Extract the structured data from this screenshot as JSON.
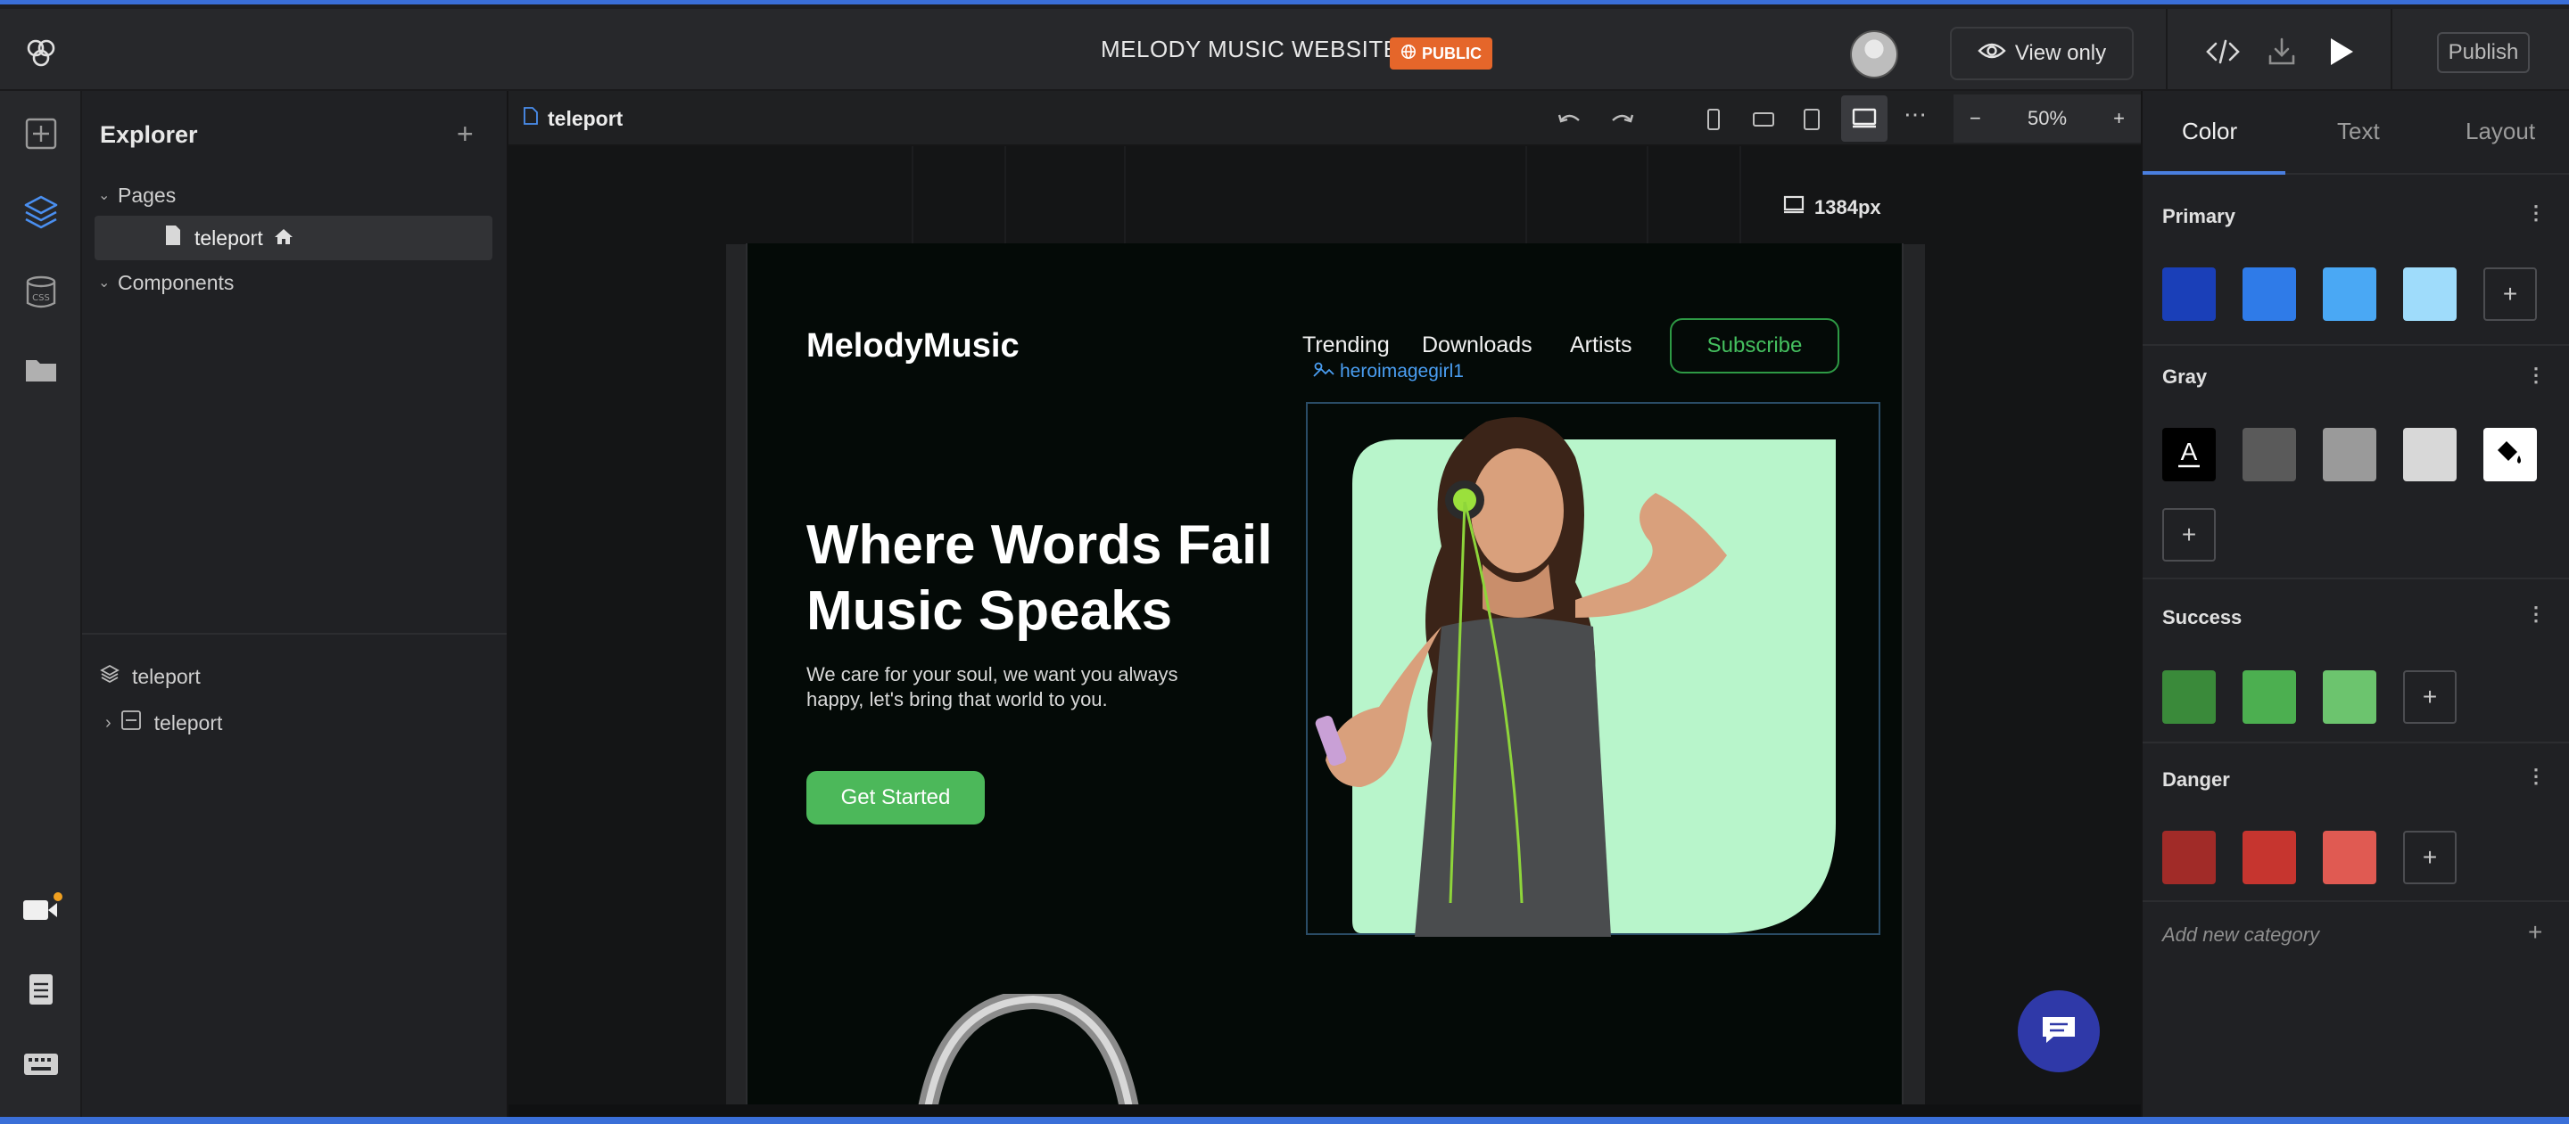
{
  "topbar": {
    "project_title": "MELODY MUSIC WEBSITE",
    "visibility_badge": "PUBLIC",
    "view_only_label": "View only",
    "publish_label": "Publish"
  },
  "explorer": {
    "title": "Explorer",
    "pages_label": "Pages",
    "page_item": "teleport",
    "components_label": "Components",
    "layer_root": "teleport",
    "layer_child": "teleport"
  },
  "canvas": {
    "tab_label": "teleport",
    "zoom_label": "50%",
    "viewport_width_label": "1384px"
  },
  "site": {
    "logo": "MelodyMusic",
    "nav": [
      "Trending",
      "Downloads",
      "Artists"
    ],
    "subscribe_label": "Subscribe",
    "image_tag": "heroimagegirl1",
    "hero_title_line1": "Where Words Fail",
    "hero_title_line2": "Music Speaks",
    "hero_sub_line1": "We care for your soul, we want you always",
    "hero_sub_line2": "happy, let's bring that world to you.",
    "cta_label": "Get Started"
  },
  "style_panel": {
    "tabs": [
      "Color",
      "Text",
      "Layout"
    ],
    "categories": [
      {
        "name": "Primary",
        "colors": [
          "#1a3fb8",
          "#2f7be8",
          "#4aa8f4",
          "#9fdcfb"
        ]
      },
      {
        "name": "Gray",
        "colors": [
          "#000000",
          "#5a5a5a",
          "#9a9a9a",
          "#d8d8d8",
          "#ffffff"
        ]
      },
      {
        "name": "Success",
        "colors": [
          "#3a8a3a",
          "#4caf50",
          "#6cc46e"
        ]
      },
      {
        "name": "Danger",
        "colors": [
          "#a12b28",
          "#c6352f",
          "#e05a52"
        ]
      }
    ],
    "add_category_label": "Add new category"
  },
  "icons": {
    "app_logo": "app-logo-icon",
    "public": "globe-icon",
    "view_only": "eye-icon",
    "code": "code-icon",
    "download": "download-icon",
    "play": "play-icon"
  }
}
